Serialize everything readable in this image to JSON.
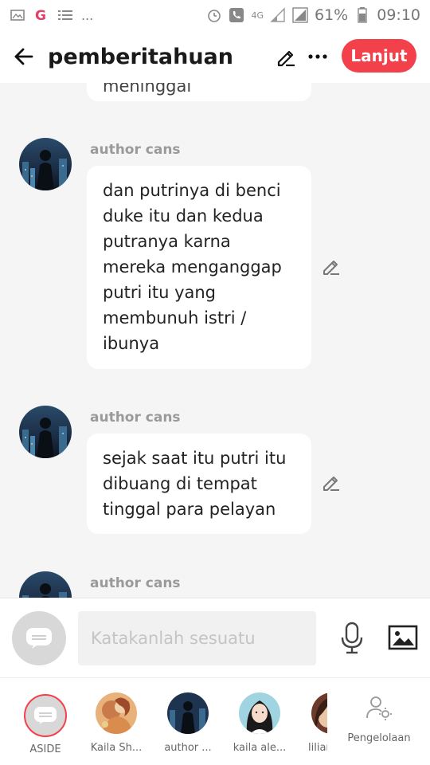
{
  "status_bar": {
    "left_text": "...",
    "network": "4G",
    "battery": "61%",
    "time": "09:10"
  },
  "header": {
    "title": "pemberitahuan",
    "next_label": "Lanjut"
  },
  "chat": {
    "partial_top_text": "meninggal",
    "messages": [
      {
        "author": "author cans",
        "text": "dan putrinya di benci duke itu dan kedua putranya karna mereka menganggap putri itu yang membunuh istri / ibunya"
      },
      {
        "author": "author cans",
        "text": "sejak saat itu putri itu dibuang di tempat tinggal para pelayan"
      },
      {
        "author": "author cans"
      }
    ]
  },
  "input": {
    "placeholder": "Katakanlah sesuatu"
  },
  "characters": [
    {
      "name": "ASIDE"
    },
    {
      "name": "Kaila Sh..."
    },
    {
      "name": "author ..."
    },
    {
      "name": "kaila ale..."
    },
    {
      "name": "liliar"
    }
  ],
  "manage": {
    "label": "Pengelolaan"
  },
  "colors": {
    "accent": "#f2414b",
    "bubble": "#ffffff",
    "background": "#f5f5f5",
    "author_text": "#9a9a9a"
  },
  "icons": {
    "back": "arrow-left-icon",
    "edit": "pencil-icon",
    "more": "more-dots-icon",
    "mic": "microphone-icon",
    "image": "image-icon",
    "manage": "user-gear-icon"
  }
}
